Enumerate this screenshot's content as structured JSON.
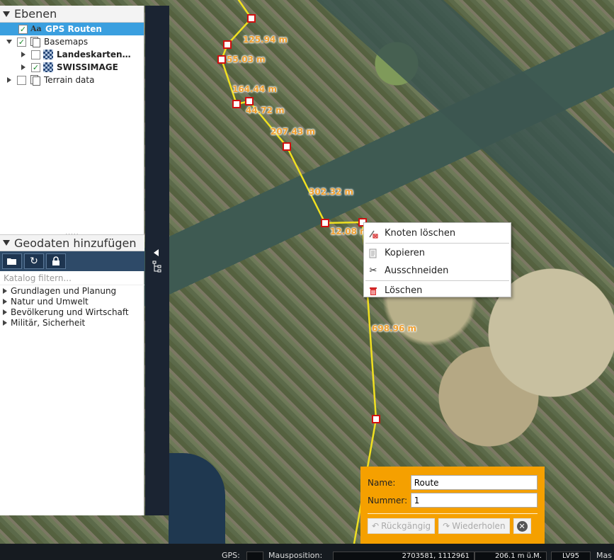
{
  "layers_panel": {
    "title": "Ebenen",
    "items": [
      {
        "label": "GPS Routen",
        "checked": true,
        "selected": true,
        "icon": "text-layer-icon"
      },
      {
        "label": "Basemaps",
        "checked": true,
        "icon": "layer-group-icon"
      },
      {
        "label": "Landeskarten…",
        "checked": false,
        "icon": "map-tile-icon"
      },
      {
        "label": "SWISSIMAGE",
        "checked": true,
        "icon": "map-tile-icon"
      },
      {
        "label": "Terrain data",
        "checked": false,
        "icon": "layer-group-icon"
      }
    ]
  },
  "geodata_panel": {
    "title": "Geodaten hinzufügen",
    "filter_placeholder": "Katalog filtern...",
    "toolbar_icons": [
      "folder-open-icon",
      "refresh-icon",
      "lock-icon"
    ],
    "categories": [
      "Grundlagen und Planung",
      "Natur und Umwelt",
      "Bevölkerung und Wirtschaft",
      "Militär, Sicherheit"
    ]
  },
  "route_labels": [
    "125.94 m",
    "55.03 m",
    "164.44 m",
    "44.72 m",
    "207.43 m",
    "302.32 m",
    "12.08 m",
    "698.96 m"
  ],
  "context_menu": {
    "items": [
      {
        "label": "Knoten löschen",
        "icon": "delete-node-icon"
      },
      {
        "label": "Kopieren",
        "icon": "copy-icon"
      },
      {
        "label": "Ausschneiden",
        "icon": "scissors-icon"
      },
      {
        "label": "Löschen",
        "icon": "trash-icon"
      }
    ]
  },
  "edit_form": {
    "name_label": "Name:",
    "name_value": "Route",
    "number_label": "Nummer:",
    "number_value": "1",
    "undo_label": "Rückgängig",
    "redo_label": "Wiederholen"
  },
  "status_bar": {
    "gps_label": "GPS:",
    "mouse_label": "Mausposition:",
    "coords": "2703581, 1112961",
    "elevation": "206.1 m ü.M.",
    "crs": "LV95",
    "scale_label": "Mas"
  },
  "colors": {
    "route": "#f0e020",
    "label": "#f0a030",
    "form_bg": "#f5a000",
    "selected": "#3a9fdf"
  }
}
